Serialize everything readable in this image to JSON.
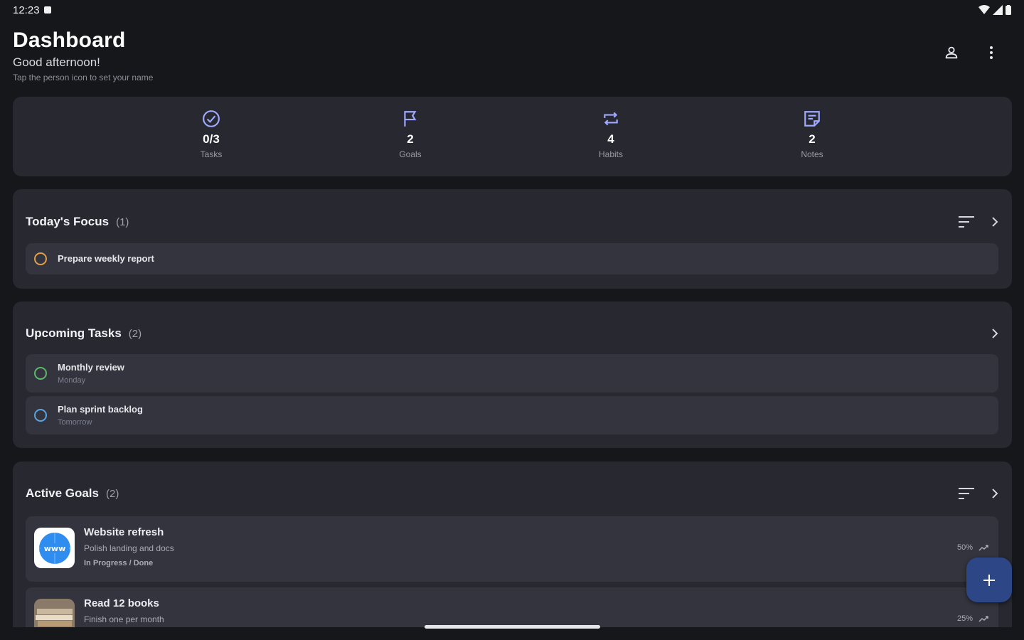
{
  "status_bar": {
    "time": "12:23"
  },
  "header": {
    "title": "Dashboard",
    "greeting": "Good afternoon!",
    "hint": "Tap the person icon to set your name"
  },
  "stats": [
    {
      "value": "0/3",
      "label": "Tasks",
      "icon": "check-circle-icon"
    },
    {
      "value": "2",
      "label": "Goals",
      "icon": "flag-icon"
    },
    {
      "value": "4",
      "label": "Habits",
      "icon": "repeat-icon"
    },
    {
      "value": "2",
      "label": "Notes",
      "icon": "note-icon"
    }
  ],
  "focus": {
    "title": "Today's Focus",
    "count": "(1)",
    "items": [
      {
        "title": "Prepare weekly report",
        "ring_color": "#e0a048"
      }
    ]
  },
  "upcoming": {
    "title": "Upcoming Tasks",
    "count": "(2)",
    "items": [
      {
        "title": "Monthly review",
        "subtitle": "Monday",
        "ring_color": "#5fb86a"
      },
      {
        "title": "Plan sprint backlog",
        "subtitle": "Tomorrow",
        "ring_color": "#5aa4e0"
      }
    ]
  },
  "goals": {
    "title": "Active Goals",
    "count": "(2)",
    "items": [
      {
        "title": "Website refresh",
        "description": "Polish landing and docs",
        "status": "In Progress / Done",
        "progress": "50%",
        "thumb_text": "www"
      },
      {
        "title": "Read 12 books",
        "description": "Finish one per month",
        "progress": "25%"
      }
    ]
  },
  "colors": {
    "background": "#16171b",
    "card": "#272830",
    "row": "#33343d",
    "accent": "#9fa9ff",
    "fab": "#2d4686"
  }
}
